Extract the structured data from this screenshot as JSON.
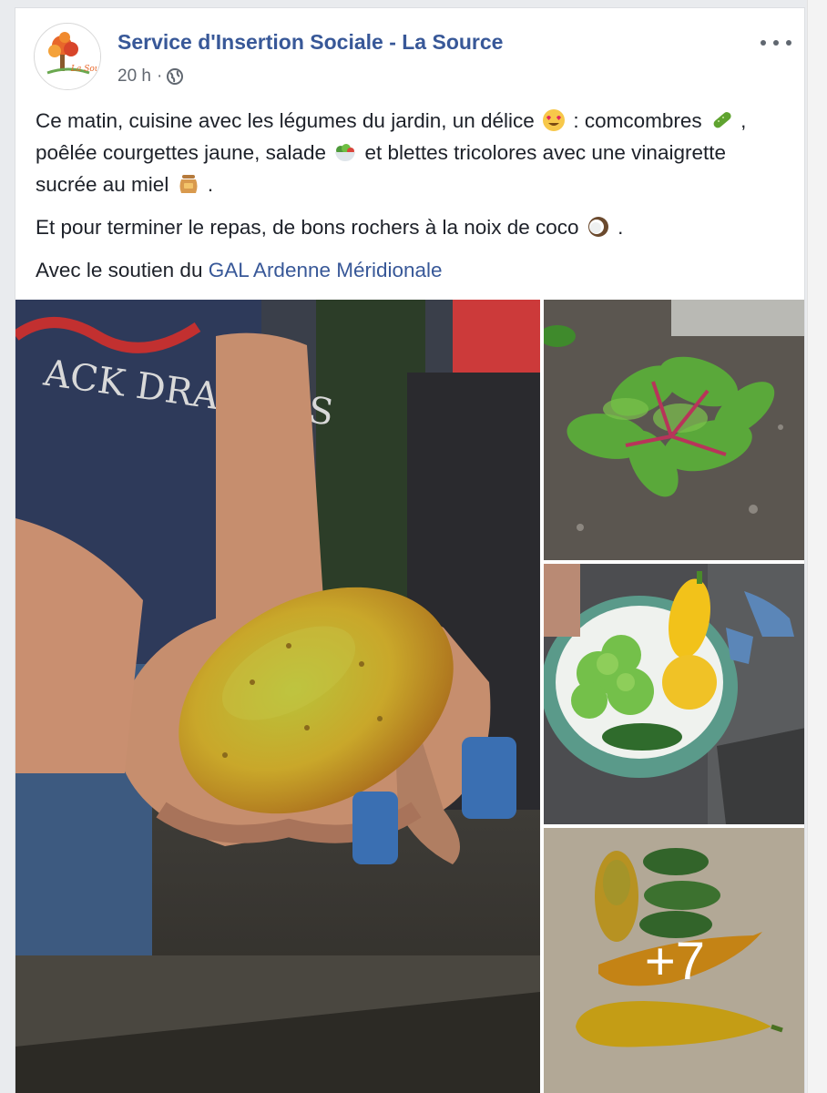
{
  "post": {
    "page_name": "Service d'Insertion Sociale - La Source",
    "time": "20 h",
    "separator": "·",
    "avatar_text": "La Sour",
    "paragraphs": {
      "p1_a": "Ce matin, cuisine avec les légumes du jardin, un délice",
      "p1_b": ": comcombres",
      "p1_c": ", poêlée courgettes jaune, salade",
      "p1_d": "et blettes tricolores avec une vinaigrette sucrée au miel",
      "p1_e": ".",
      "p2_a": "Et pour terminer le repas, de bons rochers à la noix de coco",
      "p2_b": ".",
      "p3_a": "Avec le soutien du",
      "p3_link": "GAL Ardenne Méridionale"
    },
    "more_photos": "+7"
  },
  "colors": {
    "link": "#385898",
    "text": "#1d2129",
    "meta": "#616770"
  },
  "icons": [
    "globe-icon",
    "more-options-icon",
    "heart-eyes-emoji-icon",
    "cucumber-emoji-icon",
    "salad-emoji-icon",
    "honey-pot-emoji-icon",
    "coconut-emoji-icon"
  ]
}
